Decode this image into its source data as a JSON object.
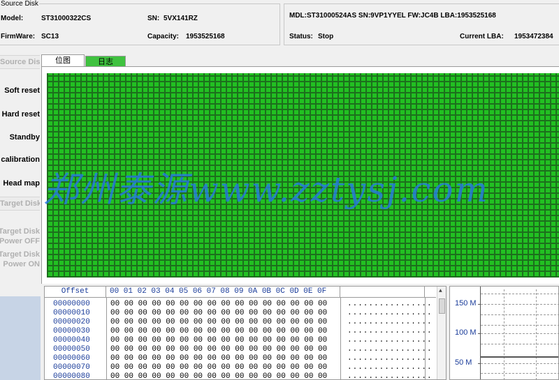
{
  "source": {
    "title": "Source Disk",
    "model_label": "Model:",
    "model": "ST31000322CS",
    "sn_label": "SN:",
    "sn": "5VX141RZ",
    "firmware_label": "FirmWare:",
    "firmware": "SC13",
    "capacity_label": "Capacity:",
    "capacity": "1953525168"
  },
  "target": {
    "mdl_line": "MDL:ST31000524AS  SN:9VP1YYEL  FW:JC4B  LBA:1953525168",
    "status_label": "Status:",
    "status": "Stop",
    "current_lba_label": "Current LBA:",
    "current_lba": "1953472384"
  },
  "left_menu": {
    "source_header": "Source Disk",
    "soft_reset": "Soft reset",
    "hard_reset": "Hard reset",
    "standby": "Standby",
    "calibration": "calibration",
    "head_map": "Head map",
    "target_header": "Target Disk",
    "target_power_off_1": "Target Disk",
    "target_power_off_2": "Power OFF",
    "target_power_on_1": "Target Disk",
    "target_power_on_2": "Power ON"
  },
  "tabs": {
    "bitmap": "位图",
    "log": "日志"
  },
  "grid": {
    "status_color": "#22c022",
    "state": "all sectors copied"
  },
  "watermark": "郑州泰源www.zztysj.com",
  "hex": {
    "offset_header": "Offset",
    "bytes_header": "00 01 02 03 04 05 06 07 08 09 0A 0B 0C 0D 0E 0F",
    "rows": [
      {
        "offset": "00000000",
        "bytes": "00 00 00 00 00 00 00 00 00 00 00 00 00 00 00 00",
        "ascii": "................"
      },
      {
        "offset": "00000010",
        "bytes": "00 00 00 00 00 00 00 00 00 00 00 00 00 00 00 00",
        "ascii": "................"
      },
      {
        "offset": "00000020",
        "bytes": "00 00 00 00 00 00 00 00 00 00 00 00 00 00 00 00",
        "ascii": "................"
      },
      {
        "offset": "00000030",
        "bytes": "00 00 00 00 00 00 00 00 00 00 00 00 00 00 00 00",
        "ascii": "................"
      },
      {
        "offset": "00000040",
        "bytes": "00 00 00 00 00 00 00 00 00 00 00 00 00 00 00 00",
        "ascii": "................"
      },
      {
        "offset": "00000050",
        "bytes": "00 00 00 00 00 00 00 00 00 00 00 00 00 00 00 00",
        "ascii": "................"
      },
      {
        "offset": "00000060",
        "bytes": "00 00 00 00 00 00 00 00 00 00 00 00 00 00 00 00",
        "ascii": "................"
      },
      {
        "offset": "00000070",
        "bytes": "00 00 00 00 00 00 00 00 00 00 00 00 00 00 00 00",
        "ascii": "................"
      },
      {
        "offset": "00000080",
        "bytes": "00 00 00 00 00 00 00 00 00 00 00 00 00 00 00 00",
        "ascii": "................"
      }
    ]
  },
  "speed_graph": {
    "label_150": "150 M",
    "label_100": "100 M",
    "label_50": "50 M"
  }
}
